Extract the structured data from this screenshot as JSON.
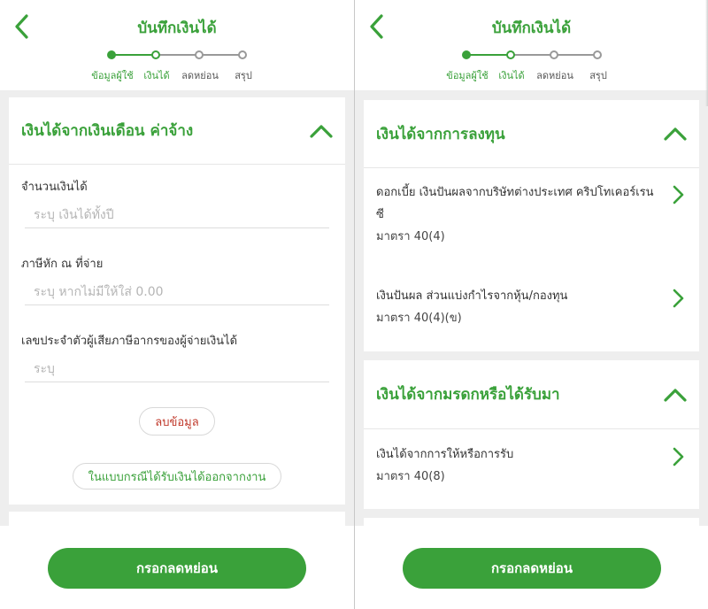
{
  "colors": {
    "primary": "#3aa13a",
    "danger": "#c0392b",
    "background": "#eeeeee"
  },
  "icons": {
    "back": "chevron-left-icon",
    "collapse": "chevron-up-icon",
    "item": "chevron-right-icon"
  },
  "left": {
    "header": {
      "title": "บันทึกเงินได้"
    },
    "stepper": {
      "current_step": 2,
      "steps": [
        "ข้อมูลผู้ใช้",
        "เงินได้",
        "ลดหย่อน",
        "สรุป"
      ]
    },
    "section": {
      "title": "เงินได้จากเงินเดือน ค่าจ้าง",
      "fields": [
        {
          "label": "จำนวนเงินได้",
          "placeholder": "ระบุ เงินได้ทั้งปี",
          "value": ""
        },
        {
          "label": "ภาษีหัก ณ ที่จ่าย",
          "placeholder": "ระบุ หากไม่มีให้ใส่ 0.00",
          "value": ""
        },
        {
          "label": "เลขประจำตัวผู้เสียภาษีอากรของผู้จ่ายเงินได้",
          "placeholder": "ระบุ",
          "value": ""
        }
      ],
      "delete_label": "ลบข้อมูล",
      "severance_label": "ในแบบกรณีได้รับเงินได้ออกจากงาน"
    },
    "footer": {
      "cta_label": "กรอกลดหย่อน"
    }
  },
  "right": {
    "header": {
      "title": "บันทึกเงินได้"
    },
    "stepper": {
      "current_step": 2,
      "steps": [
        "ข้อมูลผู้ใช้",
        "เงินได้",
        "ลดหย่อน",
        "สรุป"
      ]
    },
    "sections": [
      {
        "title": "เงินได้จากการลงทุน",
        "items": [
          {
            "title": "ดอกเบี้ย เงินปันผลจากบริษัทต่างประเทศ คริปโทเคอร์เรนซี",
            "subtitle": "มาตรา 40(4)"
          },
          {
            "title": "เงินปันผล ส่วนแบ่งกำไรจากหุ้น/กองทุน",
            "subtitle": "มาตรา 40(4)(ข)"
          }
        ]
      },
      {
        "title": "เงินได้จากมรดกหรือได้รับมา",
        "items": [
          {
            "title": "เงินได้จากการให้หรือการรับ",
            "subtitle": "มาตรา 40(8)"
          }
        ]
      }
    ],
    "footer": {
      "cta_label": "กรอกลดหย่อน"
    }
  }
}
